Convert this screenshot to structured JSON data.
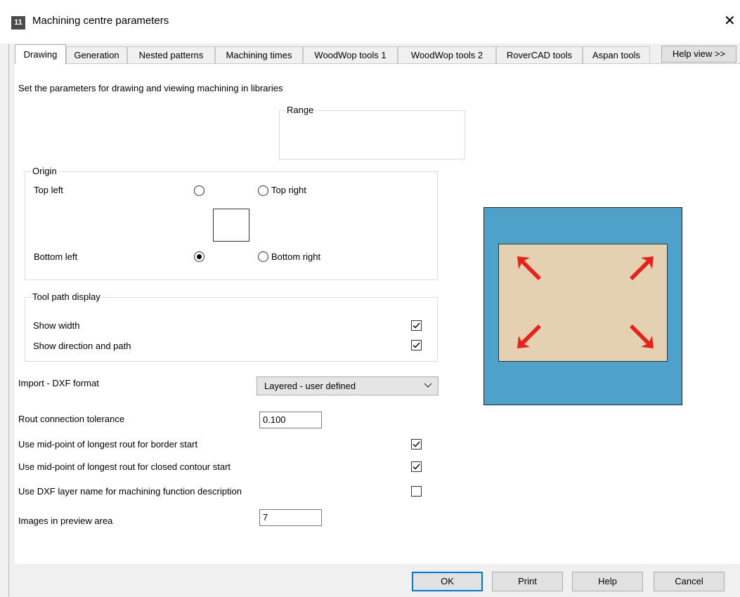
{
  "window": {
    "title": "Machining centre parameters",
    "icon_label": "11",
    "close_glyph": "✕"
  },
  "tabs": [
    {
      "label": "Drawing",
      "active": true
    },
    {
      "label": "Generation"
    },
    {
      "label": "Nested patterns"
    },
    {
      "label": "Machining times"
    },
    {
      "label": "WoodWop tools 1"
    },
    {
      "label": "WoodWop tools 2"
    },
    {
      "label": "RoverCAD tools"
    },
    {
      "label": "Aspan tools"
    }
  ],
  "help_view_label": "Help view >>",
  "description": "Set the parameters for drawing and viewing machining in libraries",
  "range": {
    "legend": "Range"
  },
  "origin": {
    "legend": "Origin",
    "top_left": "Top left",
    "top_right": "Top right",
    "bottom_left": "Bottom left",
    "bottom_right": "Bottom right",
    "selected": "bottom_left"
  },
  "toolpath": {
    "legend": "Tool path display",
    "show_width": {
      "label": "Show width",
      "checked": true
    },
    "show_direction": {
      "label": "Show direction and path",
      "checked": true
    }
  },
  "import_dxf": {
    "label": "Import - DXF format",
    "value": "Layered - user defined"
  },
  "rout_tolerance": {
    "label": "Rout connection tolerance",
    "value": "0.100"
  },
  "midpoint_border": {
    "label": "Use mid-point of longest rout for border start",
    "checked": true
  },
  "midpoint_closed": {
    "label": "Use mid-point of longest rout for closed contour start",
    "checked": true
  },
  "dxf_layer_name": {
    "label": "Use DXF layer name for machining function description",
    "checked": false
  },
  "images_preview": {
    "label": "Images in preview area",
    "value": "7"
  },
  "buttons": {
    "ok": "OK",
    "print": "Print",
    "help": "Help",
    "cancel": "Cancel"
  },
  "colors": {
    "preview_bg": "#4ea1c8",
    "board": "#e3d1b2",
    "arrow": "#e8221a",
    "default_button_border": "#0078d7"
  }
}
